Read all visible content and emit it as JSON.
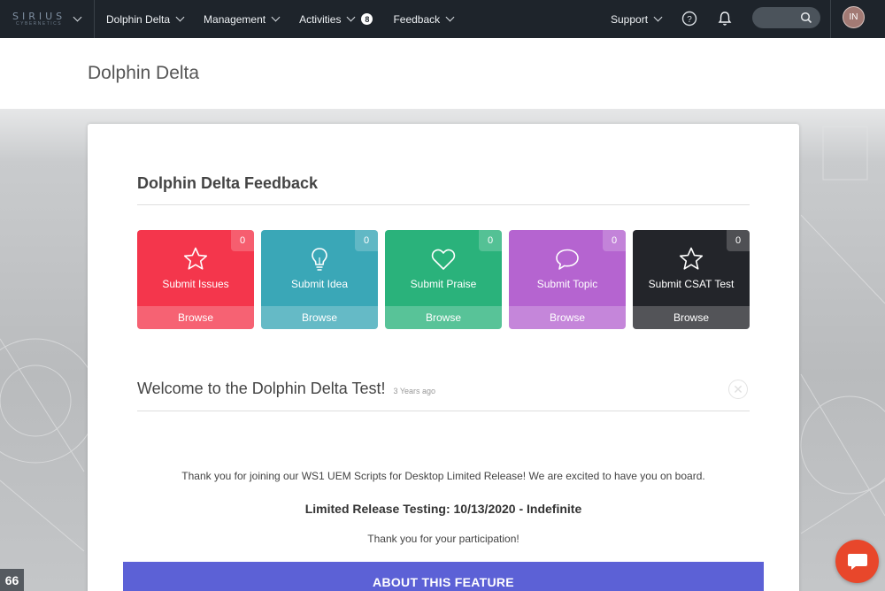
{
  "nav": {
    "logo_main": "SIRIUS",
    "logo_sub": "CYBERNETICS",
    "items": [
      {
        "label": "Dolphin Delta"
      },
      {
        "label": "Management"
      },
      {
        "label": "Activities",
        "badge": "8"
      },
      {
        "label": "Feedback"
      }
    ],
    "support_label": "Support",
    "help_icon": "question-circle-icon",
    "notifications_icon": "bell-icon",
    "search_icon": "search-icon",
    "avatar_initials": "IN"
  },
  "header": {
    "title": "Dolphin Delta"
  },
  "feedback": {
    "title": "Dolphin Delta Feedback",
    "tiles": [
      {
        "label": "Submit Issues",
        "count": "0",
        "browse": "Browse",
        "icon": "star-icon",
        "color": "#f4364c"
      },
      {
        "label": "Submit Idea",
        "count": "0",
        "browse": "Browse",
        "icon": "lightbulb-icon",
        "color": "#3aa7b7"
      },
      {
        "label": "Submit Praise",
        "count": "0",
        "browse": "Browse",
        "icon": "heart-icon",
        "color": "#2ab27b"
      },
      {
        "label": "Submit Topic",
        "count": "0",
        "browse": "Browse",
        "icon": "speech-bubble-icon",
        "color": "#b564d0"
      },
      {
        "label": "Submit CSAT Test",
        "count": "0",
        "browse": "Browse",
        "icon": "star-icon",
        "color": "#23252a"
      }
    ]
  },
  "welcome": {
    "title": "Welcome to the Dolphin Delta Test!",
    "ago": "3 Years ago",
    "para1": "Thank you for joining our  WS1 UEM Scripts for Desktop Limited Release! We are excited to have you on board.",
    "para2": "Limited Release Testing:  10/13/2020  - Indefinite",
    "para3": "Thank you for your participation!",
    "about_label": "ABOUT THIS FEATURE"
  },
  "quote_tab": "66",
  "chat_icon": "chat-bubble-icon"
}
